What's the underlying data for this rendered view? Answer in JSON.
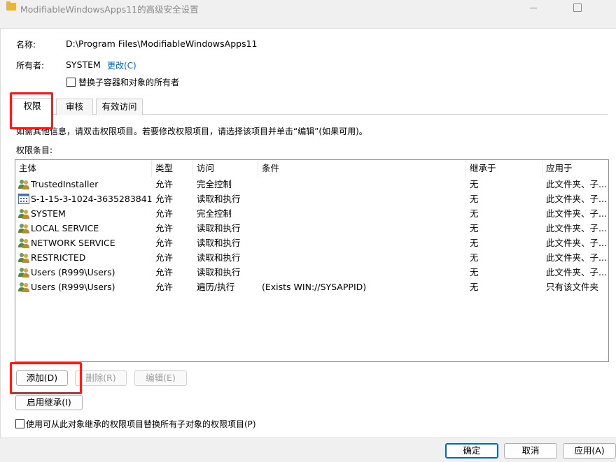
{
  "window": {
    "title": "ModifiableWindowsApps11的高级安全设置"
  },
  "name_label": "名称:",
  "name_value": "D:\\Program Files\\ModifiableWindowsApps11",
  "owner_label": "所有者:",
  "owner_value": "SYSTEM",
  "change_link": "更改(C)",
  "replace_owner_checkbox": {
    "label": "替换子容器和对象的所有者",
    "checked": false
  },
  "tabs": [
    {
      "label": "权限",
      "active": true
    },
    {
      "label": "审核",
      "active": false
    },
    {
      "label": "有效访问",
      "active": false
    }
  ],
  "info_text": "如需其他信息，请双击权限项目。若要修改权限项目，请选择该项目并单击“编辑”(如果可用)。",
  "entries_label": "权限条目:",
  "table": {
    "columns": [
      "主体",
      "类型",
      "访问",
      "条件",
      "继承于",
      "应用于"
    ],
    "rows": [
      {
        "icon": "users-icon",
        "principal": "TrustedInstaller",
        "type": "允许",
        "access": "完全控制",
        "condition": "",
        "inherited": "无",
        "applies": "此文件夹、子..."
      },
      {
        "icon": "app-package-icon",
        "principal": "S-1-15-3-1024-3635283841...",
        "type": "允许",
        "access": "读取和执行",
        "condition": "",
        "inherited": "无",
        "applies": "此文件夹、子..."
      },
      {
        "icon": "users-icon",
        "principal": "SYSTEM",
        "type": "允许",
        "access": "完全控制",
        "condition": "",
        "inherited": "无",
        "applies": "此文件夹、子..."
      },
      {
        "icon": "users-icon",
        "principal": "LOCAL SERVICE",
        "type": "允许",
        "access": "读取和执行",
        "condition": "",
        "inherited": "无",
        "applies": "此文件夹、子..."
      },
      {
        "icon": "users-icon",
        "principal": "NETWORK SERVICE",
        "type": "允许",
        "access": "读取和执行",
        "condition": "",
        "inherited": "无",
        "applies": "此文件夹、子..."
      },
      {
        "icon": "users-icon",
        "principal": "RESTRICTED",
        "type": "允许",
        "access": "读取和执行",
        "condition": "",
        "inherited": "无",
        "applies": "此文件夹、子..."
      },
      {
        "icon": "users-icon",
        "principal": "Users (R999\\Users)",
        "type": "允许",
        "access": "读取和执行",
        "condition": "",
        "inherited": "无",
        "applies": "此文件夹、子..."
      },
      {
        "icon": "users-icon",
        "principal": "Users (R999\\Users)",
        "type": "允许",
        "access": "遍历/执行",
        "condition": "(Exists WIN://SYSAPPID)",
        "inherited": "无",
        "applies": "只有该文件夹"
      }
    ]
  },
  "buttons": {
    "add": "添加(D)",
    "remove": "删除(R)",
    "edit": "编辑(E)",
    "enable_inheritance": "启用继承(I)"
  },
  "replace_child_checkbox": {
    "label": "使用可从此对象继承的权限项目替换所有子对象的权限项目(P)",
    "checked": false
  },
  "footer": {
    "ok": "确定",
    "cancel": "取消",
    "apply": "应用(A)"
  }
}
